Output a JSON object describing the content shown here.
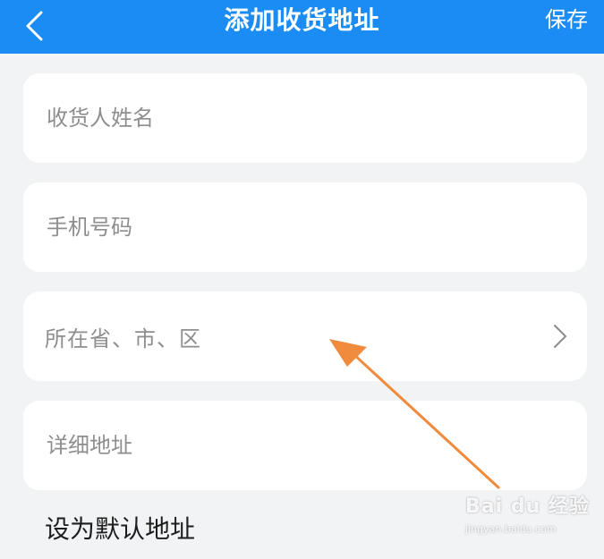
{
  "header": {
    "title": "添加收货地址",
    "save_label": "保存",
    "background_color": "#1c8cf5"
  },
  "form": {
    "name_placeholder": "收货人姓名",
    "phone_placeholder": "手机号码",
    "region_label": "所在省、市、区",
    "detail_placeholder": "详细地址"
  },
  "default_address_label": "设为默认地址",
  "annotation": {
    "arrow_color": "#f08a3c"
  },
  "watermark": {
    "logo_text": "Bai du 经验",
    "url_text": "jingyan.baidu.com"
  }
}
